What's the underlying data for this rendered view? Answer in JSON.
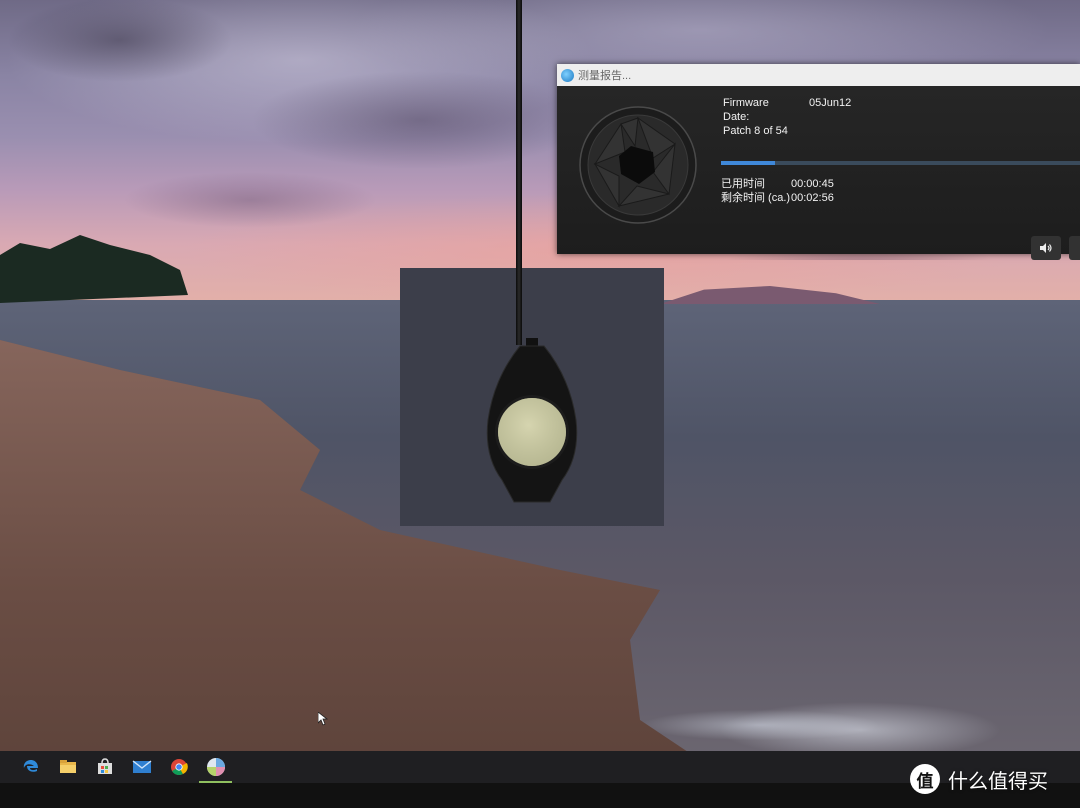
{
  "player": {
    "window_title": "测量报告...",
    "firmware_label": "Firmware Date:",
    "firmware_value": "05Jun12",
    "patch_text": "Patch 8 of 54",
    "progress": 0.15,
    "elapsed_label": "已用时间",
    "elapsed_value": "00:00:45",
    "remaining_label": "剩余时间 (ca.)",
    "remaining_value": "00:02:56",
    "volume_icon": "speaker-icon",
    "accent_color": "#3f88d9"
  },
  "taskbar": {
    "items": [
      {
        "icon": "edge-browser-icon"
      },
      {
        "icon": "file-explorer-icon"
      },
      {
        "icon": "store-icon"
      },
      {
        "icon": "mail-icon"
      },
      {
        "icon": "chrome-icon"
      },
      {
        "icon": "calibration-app-icon",
        "active": true
      }
    ]
  },
  "watermark": {
    "text": "什么值得买",
    "logo_char": "值"
  }
}
